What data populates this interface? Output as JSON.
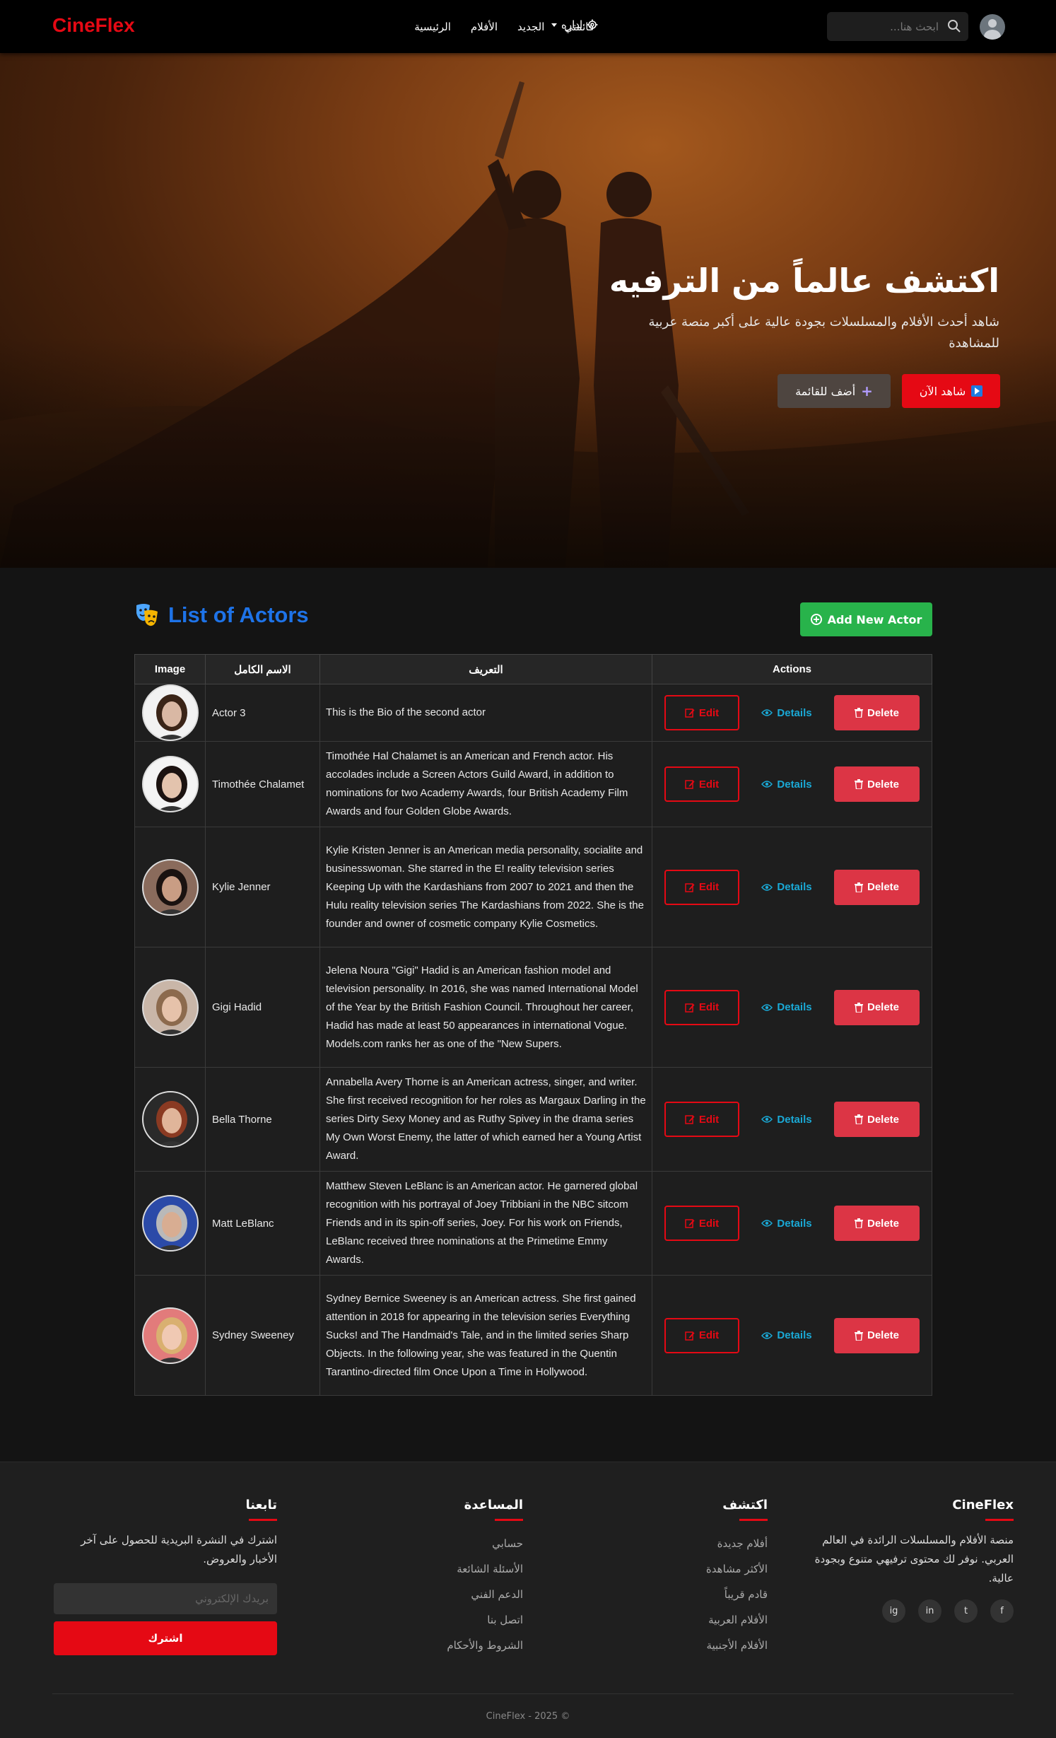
{
  "brand": "CineFlex",
  "nav": {
    "search_placeholder": "ابحث هنا...",
    "links": [
      "قائمتي",
      "الجديد",
      "الأفلام",
      "الرئيسية"
    ],
    "admin_label": "اداره"
  },
  "hero": {
    "title": "اكتشف عالماً من الترفيه",
    "subtitle": "شاهد أحدث الأفلام والمسلسلات بجودة عالية على أكبر منصة عربية للمشاهدة",
    "watch_label": "شاهد الآن",
    "add_label": "أضف للقائمة"
  },
  "list": {
    "title": "List of Actors",
    "add_button": "Add New Actor",
    "headers": {
      "image": "Image",
      "name": "الاسم الكامل",
      "bio": "التعريف",
      "actions": "Actions"
    },
    "action_labels": {
      "edit": "Edit",
      "details": "Details",
      "delete": "Delete"
    },
    "rows": [
      {
        "name": "Actor 3",
        "bio": "This is the Bio of the second actor",
        "skin": "#d9b8a4",
        "hair": "#3a2417",
        "bg": "#f2f2f2"
      },
      {
        "name": "Timothée Chalamet",
        "bio": "Timothée Hal Chalamet is an American and French actor. His accolades include a Screen Actors Guild Award, in addition to nominations for two Academy Awards, four British Academy Film Awards and four Golden Globe Awards.",
        "skin": "#e3c3ad",
        "hair": "#1b1210",
        "bg": "#f4f4f4"
      },
      {
        "name": "Kylie Jenner",
        "bio": "Kylie Kristen Jenner is an American media personality, socialite and businesswoman. She starred in the E! reality television series Keeping Up with the Kardashians from 2007 to 2021 and then the Hulu reality television series The Kardashians from 2022. She is the founder and owner of cosmetic company Kylie Cosmetics.",
        "skin": "#c99d84",
        "hair": "#1a1210",
        "bg": "#8a6b5c"
      },
      {
        "name": "Gigi Hadid",
        "bio": "Jelena Noura \"Gigi\" Hadid is an American fashion model and television personality. In 2016, she was named International Model of the Year by the British Fashion Council. Throughout her career, Hadid has made at least 50 appearances in international Vogue. Models.com ranks her as one of the \"New Supers.",
        "skin": "#e6c2aa",
        "hair": "#8c6a4d",
        "bg": "#c9b6a8"
      },
      {
        "name": "Bella Thorne",
        "bio": "Annabella Avery Thorne is an American actress, singer, and writer. She first received recognition for her roles as Margaux Darling in the series Dirty Sexy Money and as Ruthy Spivey in the drama series My Own Worst Enemy, the latter of which earned her a Young Artist Award.",
        "skin": "#e0b59a",
        "hair": "#8a3a22",
        "bg": "#2a2a2a"
      },
      {
        "name": "Matt LeBlanc",
        "bio": "Matthew Steven LeBlanc is an American actor. He garnered global recognition with his portrayal of Joey Tribbiani in the NBC sitcom Friends and in its spin-off series, Joey. For his work on Friends, LeBlanc received three nominations at the Primetime Emmy Awards.",
        "skin": "#d8ad92",
        "hair": "#b9b9b9",
        "bg": "#2b4aa8"
      },
      {
        "name": "Sydney Sweeney",
        "bio": "Sydney Bernice Sweeney is an American actress. She first gained attention in 2018 for appearing in the television series Everything Sucks! and The Handmaid's Tale, and in the limited series Sharp Objects. In the following year, she was featured in the Quentin Tarantino-directed film Once Upon a Time in Hollywood.",
        "skin": "#f0c9b3",
        "hair": "#d9b070",
        "bg": "#e27b7b"
      }
    ]
  },
  "footer": {
    "about": {
      "title": "CineFlex",
      "text": "منصة الأفلام والمسلسلات الرائدة في العالم العربي. نوفر لك محتوى ترفيهي متنوع وبجودة عالية."
    },
    "socials": [
      "f",
      "t",
      "in",
      "ig"
    ],
    "explore": {
      "title": "اكتشف",
      "items": [
        "أفلام جديدة",
        "الأكثر مشاهدة",
        "قادم قريباً",
        "الأفلام العربية",
        "الأفلام الأجنبية"
      ]
    },
    "help": {
      "title": "المساعدة",
      "items": [
        "حسابي",
        "الأسئلة الشائعة",
        "الدعم الفني",
        "اتصل بنا",
        "الشروط والأحكام"
      ]
    },
    "follow": {
      "title": "تابعنا",
      "text": "اشترك في النشرة البريدية للحصول على آخر الأخبار والعروض.",
      "email_placeholder": "بريدك الإلكتروني",
      "subscribe_label": "اشترك"
    },
    "copyright": "CineFlex - 2025 ©"
  },
  "colors": {
    "brand_red": "#e50914",
    "accent_blue": "#1e73e8",
    "success_green": "#28b34b",
    "danger": "#dc3545",
    "info": "#1aa9d6"
  }
}
